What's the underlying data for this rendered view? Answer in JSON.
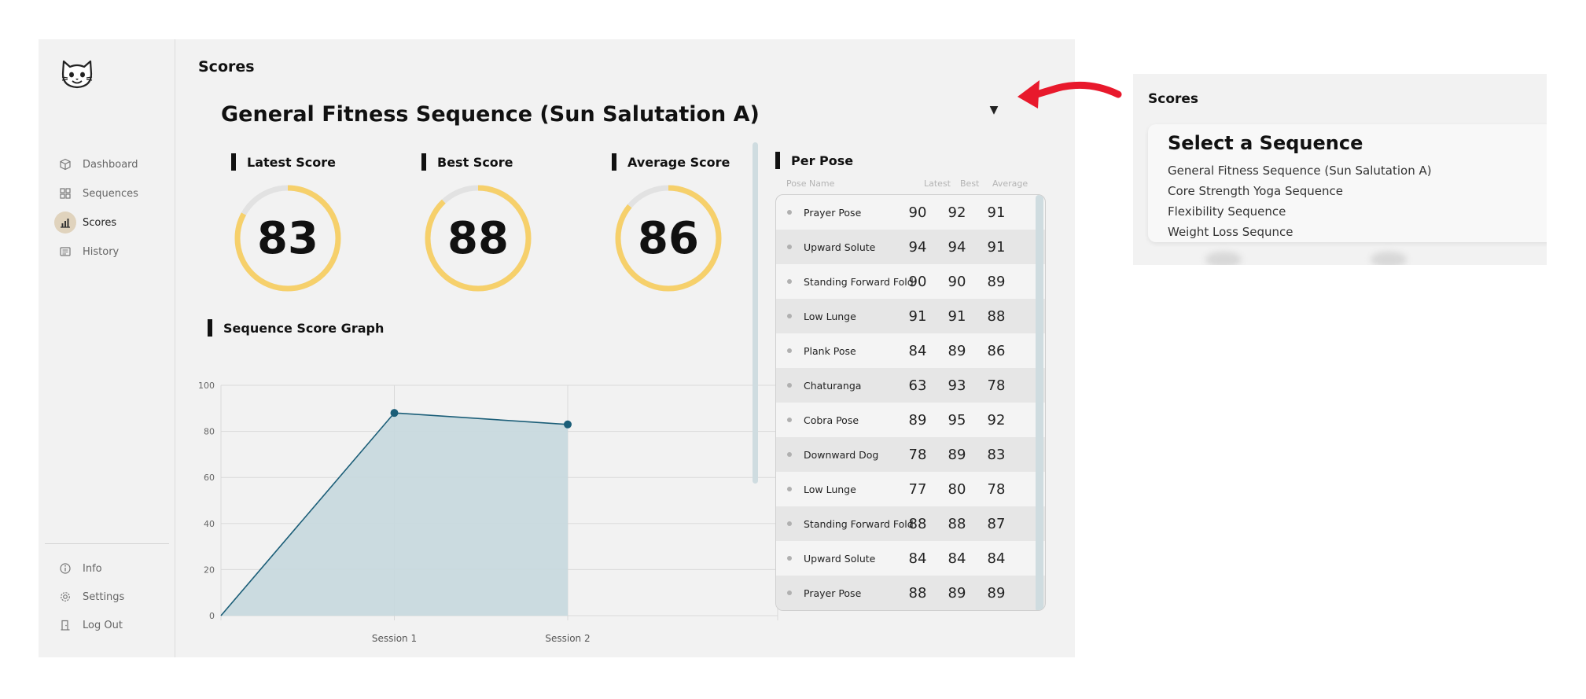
{
  "app": {
    "page_title": "Scores"
  },
  "sidebar": {
    "items": [
      {
        "label": "Dashboard",
        "icon": "cube-icon"
      },
      {
        "label": "Sequences",
        "icon": "grid-icon"
      },
      {
        "label": "Scores",
        "icon": "bar-chart-icon",
        "active": true
      },
      {
        "label": "History",
        "icon": "list-icon"
      }
    ],
    "bottom_items": [
      {
        "label": "Info",
        "icon": "info-icon"
      },
      {
        "label": "Settings",
        "icon": "gear-icon"
      },
      {
        "label": "Log Out",
        "icon": "door-icon"
      }
    ]
  },
  "sequence": {
    "title": "General Fitness Sequence (Sun Salutation A)"
  },
  "scores": {
    "latest": {
      "label": "Latest Score",
      "value": "83",
      "fraction": 0.83
    },
    "best": {
      "label": "Best Score",
      "value": "88",
      "fraction": 0.88
    },
    "average": {
      "label": "Average Score",
      "value": "86",
      "fraction": 0.86
    }
  },
  "graph": {
    "label": "Sequence Score Graph"
  },
  "chart_data": {
    "type": "area",
    "x": [
      "",
      "Session 1",
      "Session 2"
    ],
    "values": [
      0,
      88,
      83
    ],
    "ylim": [
      0,
      100
    ],
    "yticks": [
      "0",
      "20",
      "40",
      "60",
      "80",
      "100"
    ],
    "grid": true,
    "colors": {
      "line": "#1b5e78",
      "fill": "#c8d9de",
      "point": "#1b5e78"
    }
  },
  "per_pose": {
    "label": "Per Pose",
    "headers": {
      "name": "Pose Name",
      "latest": "Latest",
      "best": "Best",
      "average": "Average"
    },
    "rows": [
      {
        "name": "Prayer Pose",
        "latest": "90",
        "best": "92",
        "average": "91"
      },
      {
        "name": "Upward Solute",
        "latest": "94",
        "best": "94",
        "average": "91"
      },
      {
        "name": "Standing Forward Fold",
        "latest": "90",
        "best": "90",
        "average": "89"
      },
      {
        "name": "Low Lunge",
        "latest": "91",
        "best": "91",
        "average": "88"
      },
      {
        "name": "Plank Pose",
        "latest": "84",
        "best": "89",
        "average": "86"
      },
      {
        "name": "Chaturanga",
        "latest": "63",
        "best": "93",
        "average": "78"
      },
      {
        "name": "Cobra Pose",
        "latest": "89",
        "best": "95",
        "average": "92"
      },
      {
        "name": "Downward Dog",
        "latest": "78",
        "best": "89",
        "average": "83"
      },
      {
        "name": "Low Lunge",
        "latest": "77",
        "best": "80",
        "average": "78"
      },
      {
        "name": "Standing Forward Fold",
        "latest": "88",
        "best": "88",
        "average": "87"
      },
      {
        "name": "Upward Solute",
        "latest": "84",
        "best": "84",
        "average": "84"
      },
      {
        "name": "Prayer Pose",
        "latest": "88",
        "best": "89",
        "average": "89"
      }
    ]
  },
  "popup": {
    "title": "Scores",
    "card_title": "Select a Sequence",
    "options": [
      "General Fitness Sequence (Sun Salutation A)",
      "Core Strength Yoga Sequence",
      "Flexibility Sequence",
      "Weight Loss Sequnce"
    ]
  },
  "colors": {
    "accent_ring": "#f6d06b",
    "ring_track": "#e2e2e2",
    "arrow": "#e8192c",
    "active_nav": "#e0d3bd"
  }
}
